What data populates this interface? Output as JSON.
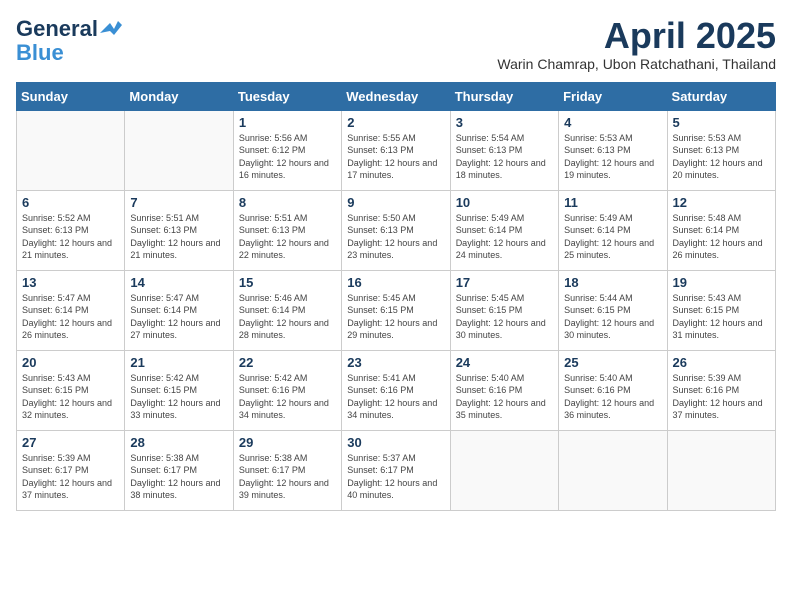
{
  "header": {
    "logo_line1": "General",
    "logo_line2": "Blue",
    "month": "April 2025",
    "location": "Warin Chamrap, Ubon Ratchathani, Thailand"
  },
  "weekdays": [
    "Sunday",
    "Monday",
    "Tuesday",
    "Wednesday",
    "Thursday",
    "Friday",
    "Saturday"
  ],
  "weeks": [
    [
      {
        "day": "",
        "info": ""
      },
      {
        "day": "",
        "info": ""
      },
      {
        "day": "1",
        "info": "Sunrise: 5:56 AM\nSunset: 6:12 PM\nDaylight: 12 hours and 16 minutes."
      },
      {
        "day": "2",
        "info": "Sunrise: 5:55 AM\nSunset: 6:13 PM\nDaylight: 12 hours and 17 minutes."
      },
      {
        "day": "3",
        "info": "Sunrise: 5:54 AM\nSunset: 6:13 PM\nDaylight: 12 hours and 18 minutes."
      },
      {
        "day": "4",
        "info": "Sunrise: 5:53 AM\nSunset: 6:13 PM\nDaylight: 12 hours and 19 minutes."
      },
      {
        "day": "5",
        "info": "Sunrise: 5:53 AM\nSunset: 6:13 PM\nDaylight: 12 hours and 20 minutes."
      }
    ],
    [
      {
        "day": "6",
        "info": "Sunrise: 5:52 AM\nSunset: 6:13 PM\nDaylight: 12 hours and 21 minutes."
      },
      {
        "day": "7",
        "info": "Sunrise: 5:51 AM\nSunset: 6:13 PM\nDaylight: 12 hours and 21 minutes."
      },
      {
        "day": "8",
        "info": "Sunrise: 5:51 AM\nSunset: 6:13 PM\nDaylight: 12 hours and 22 minutes."
      },
      {
        "day": "9",
        "info": "Sunrise: 5:50 AM\nSunset: 6:13 PM\nDaylight: 12 hours and 23 minutes."
      },
      {
        "day": "10",
        "info": "Sunrise: 5:49 AM\nSunset: 6:14 PM\nDaylight: 12 hours and 24 minutes."
      },
      {
        "day": "11",
        "info": "Sunrise: 5:49 AM\nSunset: 6:14 PM\nDaylight: 12 hours and 25 minutes."
      },
      {
        "day": "12",
        "info": "Sunrise: 5:48 AM\nSunset: 6:14 PM\nDaylight: 12 hours and 26 minutes."
      }
    ],
    [
      {
        "day": "13",
        "info": "Sunrise: 5:47 AM\nSunset: 6:14 PM\nDaylight: 12 hours and 26 minutes."
      },
      {
        "day": "14",
        "info": "Sunrise: 5:47 AM\nSunset: 6:14 PM\nDaylight: 12 hours and 27 minutes."
      },
      {
        "day": "15",
        "info": "Sunrise: 5:46 AM\nSunset: 6:14 PM\nDaylight: 12 hours and 28 minutes."
      },
      {
        "day": "16",
        "info": "Sunrise: 5:45 AM\nSunset: 6:15 PM\nDaylight: 12 hours and 29 minutes."
      },
      {
        "day": "17",
        "info": "Sunrise: 5:45 AM\nSunset: 6:15 PM\nDaylight: 12 hours and 30 minutes."
      },
      {
        "day": "18",
        "info": "Sunrise: 5:44 AM\nSunset: 6:15 PM\nDaylight: 12 hours and 30 minutes."
      },
      {
        "day": "19",
        "info": "Sunrise: 5:43 AM\nSunset: 6:15 PM\nDaylight: 12 hours and 31 minutes."
      }
    ],
    [
      {
        "day": "20",
        "info": "Sunrise: 5:43 AM\nSunset: 6:15 PM\nDaylight: 12 hours and 32 minutes."
      },
      {
        "day": "21",
        "info": "Sunrise: 5:42 AM\nSunset: 6:15 PM\nDaylight: 12 hours and 33 minutes."
      },
      {
        "day": "22",
        "info": "Sunrise: 5:42 AM\nSunset: 6:16 PM\nDaylight: 12 hours and 34 minutes."
      },
      {
        "day": "23",
        "info": "Sunrise: 5:41 AM\nSunset: 6:16 PM\nDaylight: 12 hours and 34 minutes."
      },
      {
        "day": "24",
        "info": "Sunrise: 5:40 AM\nSunset: 6:16 PM\nDaylight: 12 hours and 35 minutes."
      },
      {
        "day": "25",
        "info": "Sunrise: 5:40 AM\nSunset: 6:16 PM\nDaylight: 12 hours and 36 minutes."
      },
      {
        "day": "26",
        "info": "Sunrise: 5:39 AM\nSunset: 6:16 PM\nDaylight: 12 hours and 37 minutes."
      }
    ],
    [
      {
        "day": "27",
        "info": "Sunrise: 5:39 AM\nSunset: 6:17 PM\nDaylight: 12 hours and 37 minutes."
      },
      {
        "day": "28",
        "info": "Sunrise: 5:38 AM\nSunset: 6:17 PM\nDaylight: 12 hours and 38 minutes."
      },
      {
        "day": "29",
        "info": "Sunrise: 5:38 AM\nSunset: 6:17 PM\nDaylight: 12 hours and 39 minutes."
      },
      {
        "day": "30",
        "info": "Sunrise: 5:37 AM\nSunset: 6:17 PM\nDaylight: 12 hours and 40 minutes."
      },
      {
        "day": "",
        "info": ""
      },
      {
        "day": "",
        "info": ""
      },
      {
        "day": "",
        "info": ""
      }
    ]
  ]
}
